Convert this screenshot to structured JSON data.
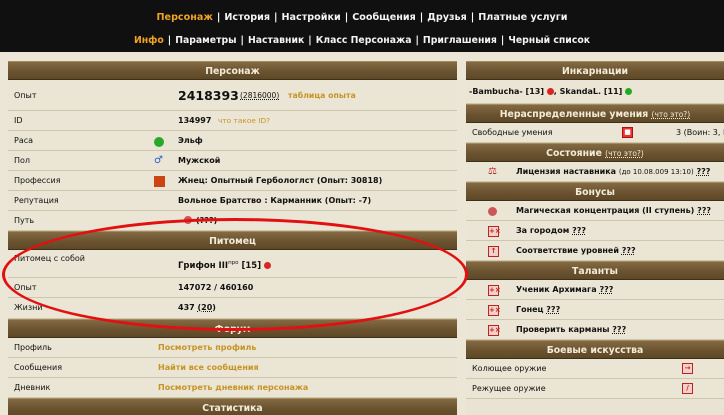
{
  "top_nav": [
    "Персонаж",
    "История",
    "Настройки",
    "Сообщения",
    "Друзья",
    "Платные услуги"
  ],
  "sub_nav": [
    "Инфо",
    "Параметры",
    "Наставник",
    "Класс Персонажа",
    "Приглашения",
    "Черный список"
  ],
  "colors": {
    "accent": "#f0a426",
    "header_bg": "#6b5330",
    "panel_bg": "#ebe5d5",
    "link": "#c69426",
    "annotation": "#e21010"
  },
  "personazh": {
    "title": "Персонаж",
    "exp_label": "Опыт",
    "exp_value": "2418393",
    "exp_extra": "(2816000)",
    "exp_link": "таблица опыта",
    "id_label": "ID",
    "id_value": "134997",
    "id_link": "что такое ID?",
    "race_label": "Раса",
    "race_value": "Эльф",
    "sex_label": "Пол",
    "sex_value": "Мужской",
    "prof_label": "Профессия",
    "prof_value": "Жнец: Опытный Гербологлст (Опыт: 30818)",
    "rep_label": "Репутация",
    "rep_value": "Вольное Братство : Карманник (Опыт: -7)",
    "path_label": "Путь",
    "path_value": "(???)"
  },
  "pet": {
    "title": "Питомец",
    "with_label": "Питомец с собой",
    "name": "Грифон III",
    "name_sup": "про",
    "level": "[15]",
    "exp_label": "Опыт",
    "exp_value": "147072 / 460160",
    "life_label": "Жизни",
    "life_value": "437",
    "life_extra": "(20)"
  },
  "forum": {
    "title": "Форум",
    "rows": [
      {
        "label": "Профиль",
        "link": "Посмотреть профиль"
      },
      {
        "label": "Сообщения",
        "link": "Найти все сообщения"
      },
      {
        "label": "Дневник",
        "link": "Посмотреть дневник персонажа"
      }
    ]
  },
  "stats": {
    "title": "Статистика"
  },
  "incarn": {
    "title": "Инкарнации",
    "char1": "-Bambucha-",
    "lvl1": "[13]",
    "char2": "SkandaL.",
    "lvl2": "[11]"
  },
  "skills": {
    "title": "Нераспределенные умения",
    "q": "(что это?)",
    "free_label": "Свободные умения",
    "free_value": "3 (Воин: 3, М"
  },
  "state": {
    "title": "Состояние",
    "q": "(что это?)",
    "item": "Лицензия наставника",
    "item_extra": "(до 10.08.009 13:10)",
    "qq": "???"
  },
  "bonus": {
    "title": "Бонусы",
    "items": [
      "Магическая концентрация (II ступень)",
      "За городом",
      "Соответствие уровней"
    ],
    "qq": "???"
  },
  "talents": {
    "title": "Таланты",
    "items": [
      "Ученик Архимага",
      "Гонец",
      "Проверить карманы"
    ],
    "qq": "???"
  },
  "combat": {
    "title": "Боевые искусства",
    "items": [
      "Колющее оружие",
      "Режущее оружие"
    ]
  }
}
